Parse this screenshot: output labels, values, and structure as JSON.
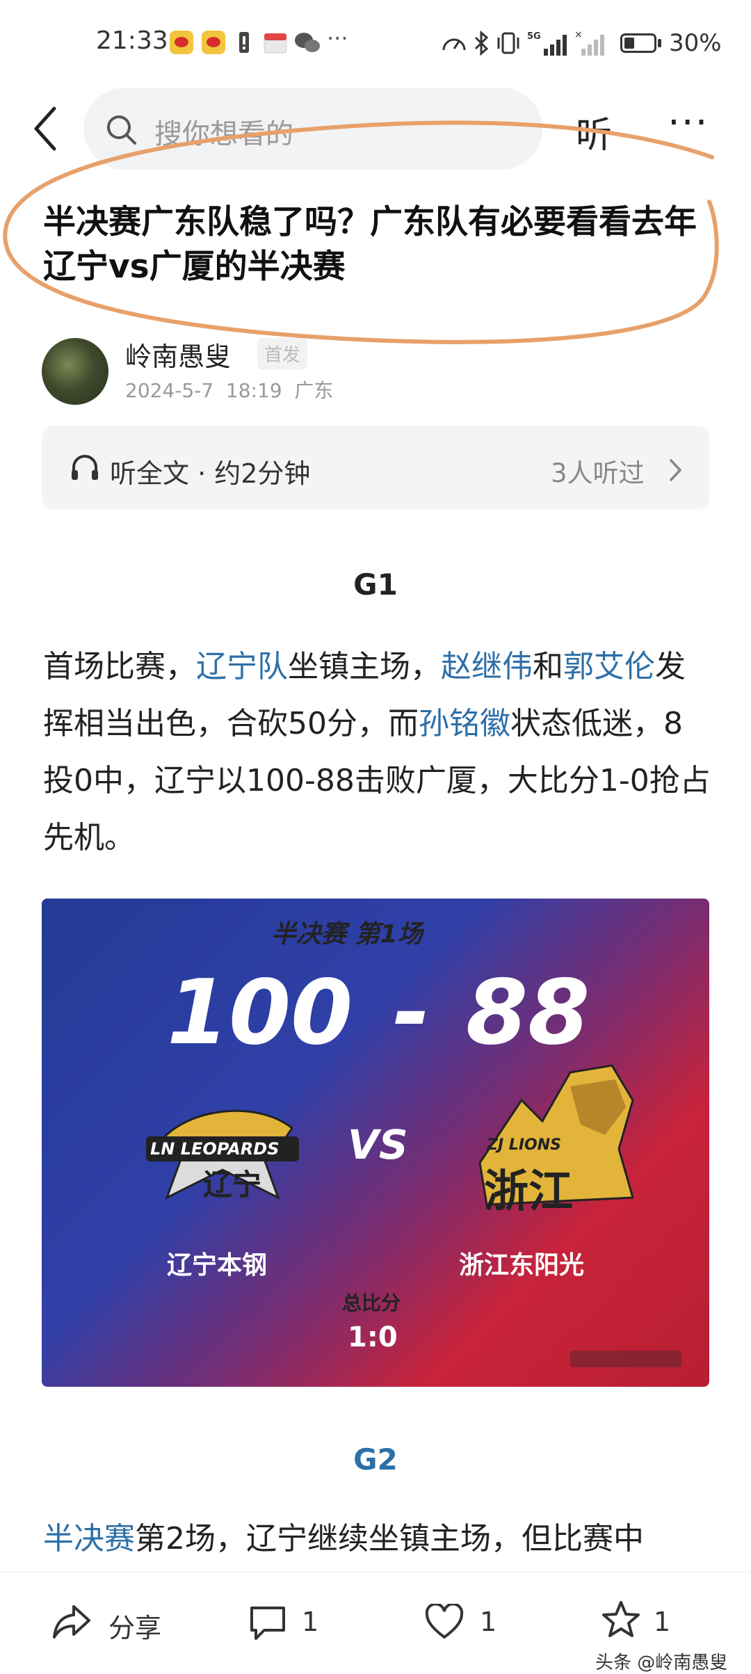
{
  "status_bar": {
    "time": "21:33",
    "battery": "30%"
  },
  "nav": {
    "search_placeholder": "搜你想看的",
    "listen": "听",
    "more": "···"
  },
  "article": {
    "title": "半决赛广东队稳了吗？广东队有必要看看去年辽宁vs广厦的半决赛",
    "author": "岭南愚叟",
    "first_badge": "首发",
    "date": "2024-5-7",
    "time": "18:19",
    "location": "广东"
  },
  "listen_bar": {
    "text": "听全文 · 约2分钟",
    "count": "3人听过"
  },
  "sections": {
    "g1": "G1",
    "g1_para": {
      "p1": "首场比赛，",
      "link1": "辽宁队",
      "p2": "坐镇主场，",
      "link2": "赵继伟",
      "p3": "和",
      "link3": "郭艾伦",
      "p4": "发挥相当出色，合砍50分，而",
      "link4": "孙铭徽",
      "p5": "状态低迷，8投0中，辽宁以100-88击败广厦，大比分1-0抢占先机。"
    },
    "g2": "G2",
    "g2_para": {
      "link1": "半决赛",
      "p1": "第2场，辽宁继续坐镇主场，但比赛中"
    }
  },
  "score_image": {
    "subtitle": "半决赛 第1场",
    "home_score": "100",
    "dash": "-",
    "away_score": "88",
    "vs": "VS",
    "home_logo_text": "LN LEOPARDS",
    "home_logo_cn": "辽宁",
    "away_logo_text": "ZJ LIONS",
    "away_logo_cn": "浙江",
    "home_team": "辽宁本钢",
    "away_team": "浙江东阳光",
    "total_label": "总比分",
    "total_score": "1:0",
    "colors": {
      "blue": "#2c3ea2",
      "red": "#c8233a",
      "gold": "#e2b43a"
    }
  },
  "bottom_bar": {
    "share": "分享",
    "comments": "1",
    "likes": "1",
    "favorites": "1",
    "watermark": "头条 @岭南愚叟"
  },
  "annotation_color": "#e8a06a"
}
